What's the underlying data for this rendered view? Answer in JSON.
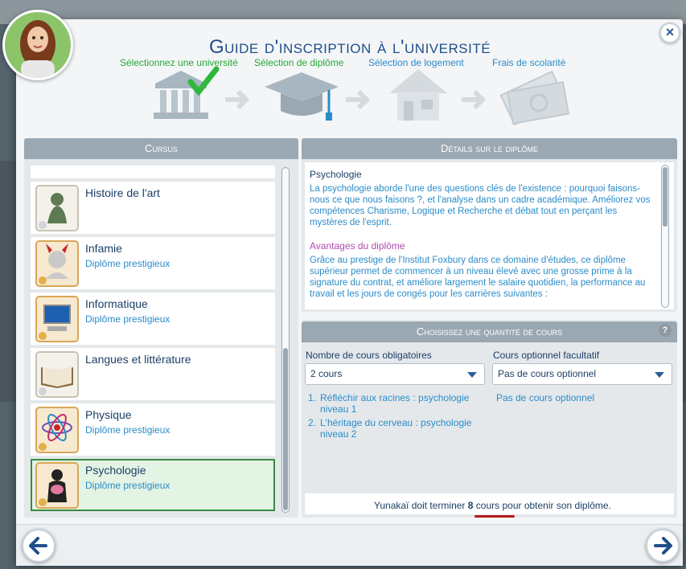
{
  "header": {
    "title": "Guide d'inscription à l'université",
    "close_label": "×"
  },
  "steps": [
    {
      "label": "Sélectionnez une université",
      "state": "done",
      "icon": "university-building-icon"
    },
    {
      "label": "Sélection de diplôme",
      "state": "current",
      "icon": "graduation-cap-icon"
    },
    {
      "label": "Sélection de logement",
      "state": "todo",
      "icon": "house-icon"
    },
    {
      "label": "Frais de scolarité",
      "state": "todo",
      "icon": "money-icon"
    }
  ],
  "cursus": {
    "header": "Cursus",
    "items": [
      {
        "name": "Histoire de l'art",
        "sub": "",
        "icon": "thinker-statue-icon"
      },
      {
        "name": "Infamie",
        "sub": "Diplôme prestigieux",
        "icon": "devil-icon"
      },
      {
        "name": "Informatique",
        "sub": "Diplôme prestigieux",
        "icon": "computer-icon"
      },
      {
        "name": "Langues et littérature",
        "sub": "",
        "icon": "book-icon"
      },
      {
        "name": "Physique",
        "sub": "Diplôme prestigieux",
        "icon": "atom-icon"
      },
      {
        "name": "Psychologie",
        "sub": "Diplôme prestigieux",
        "icon": "brain-icon",
        "selected": true
      }
    ]
  },
  "details": {
    "header": "Détails sur le diplôme",
    "title": "Psychologie",
    "description": "La psychologie aborde l'une des questions clés de l'existence  : pourquoi faisons-nous ce que nous faisons  ?, et l'analyse dans un cadre académique. Améliorez vos compétences Charisme, Logique et Recherche et débat tout en perçant les mystères de l'esprit.",
    "advantages_title": "Avantages du diplôme",
    "advantages_text": "Grâce au prestige de l'Institut Foxbury dans ce domaine d'études, ce diplôme supérieur permet de commencer à un niveau élevé avec une grosse prime à la signature du contrat, et améliore largement le salaire quotidien, la performance au travail et les jours de congés pour les carrières suivantes  :"
  },
  "courses": {
    "header": "Choisissez une quantité de cours",
    "help_label": "?",
    "required_label": "Nombre de cours obligatoires",
    "required_value": "2  cours",
    "optional_label": "Cours optionnel facultatif",
    "optional_value": "Pas de cours optionnel",
    "required_list": [
      {
        "num": "1.",
        "text": "Réfléchir aux racines  : psychologie niveau 1"
      },
      {
        "num": "2.",
        "text": "L'héritage du cerveau  : psychologie niveau 2"
      }
    ],
    "optional_none": "Pas de cours optionnel"
  },
  "footer": {
    "sim_name": "Yunakaï",
    "text_before": "doit terminer",
    "count": "8",
    "text_after": "cours pour obtenir son diplôme."
  },
  "colors": {
    "accent_blue": "#2a8cc9",
    "done_green": "#27a834",
    "selected_border": "#3a8a40",
    "header_gray": "#9aa8b3"
  }
}
